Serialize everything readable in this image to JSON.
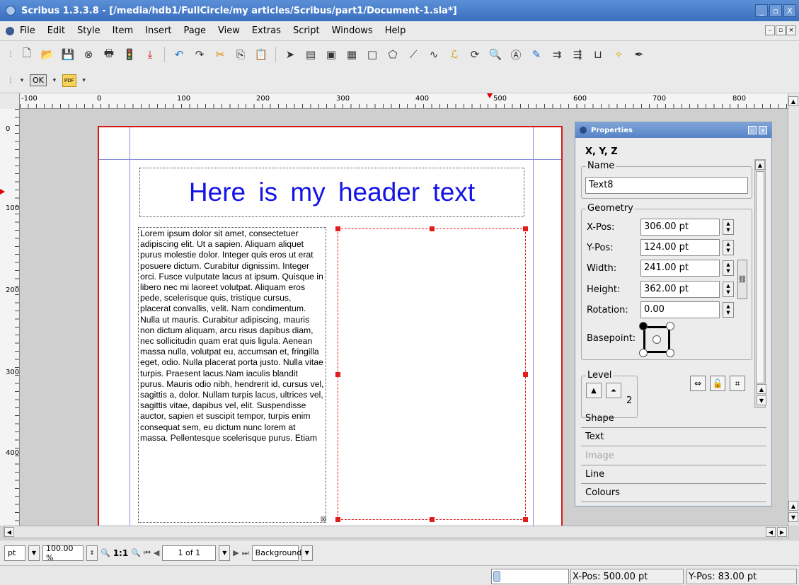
{
  "window": {
    "title": "Scribus 1.3.3.8 - [/media/hdb1/FullCircle/my articles/Scribus/part1/Document-1.sla*]",
    "buttons": [
      "_",
      "▫",
      "X"
    ]
  },
  "menubar": {
    "items": [
      "File",
      "Edit",
      "Style",
      "Item",
      "Insert",
      "Page",
      "View",
      "Extras",
      "Script",
      "Windows",
      "Help"
    ]
  },
  "toolbar2": {
    "ok_label": "OK",
    "pdf_label": "PDF"
  },
  "ruler": {
    "h_labels": [
      "-100",
      "0",
      "100",
      "200",
      "300",
      "400",
      "500",
      "600",
      "700",
      "800"
    ],
    "v_labels": [
      "0",
      "100",
      "200",
      "300",
      "400"
    ]
  },
  "document": {
    "header_text": "Here is my header text",
    "body_text": "Lorem ipsum dolor sit amet, consectetuer adipiscing elit. Ut a sapien. Aliquam aliquet purus molestie dolor. Integer quis eros ut erat posuere dictum. Curabitur dignissim. Integer orci. Fusce vulputate lacus at ipsum. Quisque in libero nec mi laoreet volutpat. Aliquam eros pede, scelerisque quis, tristique cursus, placerat convallis, velit. Nam condimentum. Nulla ut mauris. Curabitur adipiscing, mauris non dictum aliquam, arcu risus dapibus diam, nec sollicitudin quam erat quis ligula. Aenean massa nulla, volutpat eu, accumsan et, fringilla eget, odio. Nulla placerat porta justo. Nulla vitae turpis. Praesent lacus.Nam iaculis blandit purus. Mauris odio nibh, hendrerit id, cursus vel, sagittis a, dolor. Nullam turpis lacus, ultrices vel, sagittis vitae, dapibus vel, elit. Suspendisse auctor, sapien et suscipit tempor, turpis enim consequat sem, eu dictum nunc lorem at massa. Pellentesque scelerisque purus. Etiam"
  },
  "properties": {
    "title": "Properties",
    "tab": "X, Y, Z",
    "name_group": "Name",
    "name_value": "Text8",
    "geometry_group": "Geometry",
    "xpos_label": "X-Pos:",
    "xpos_value": "306.00 pt",
    "ypos_label": "Y-Pos:",
    "ypos_value": "124.00 pt",
    "width_label": "Width:",
    "width_value": "241.00 pt",
    "height_label": "Height:",
    "height_value": "362.00 pt",
    "rotation_label": "Rotation:",
    "rotation_value": "0.00",
    "basepoint_label": "Basepoint:",
    "level_group": "Level",
    "level_value": "2",
    "sections": [
      "Shape",
      "Text",
      "Image",
      "Line",
      "Colours"
    ]
  },
  "navbar": {
    "unit": "pt",
    "zoom": "100.00 %",
    "zoom_1to1": "1:1",
    "page": "1 of 1",
    "layer": "Background"
  },
  "statusbar": {
    "xpos_label": "X-Pos:",
    "xpos_value": "500.00 pt",
    "ypos_label": "Y-Pos:",
    "ypos_value": "83.00 pt"
  },
  "colors": {
    "header_text": "#1414e6",
    "page_border": "#d61a1a",
    "guides": "#8b8bdc",
    "titlebar": "#3a6fc0"
  }
}
